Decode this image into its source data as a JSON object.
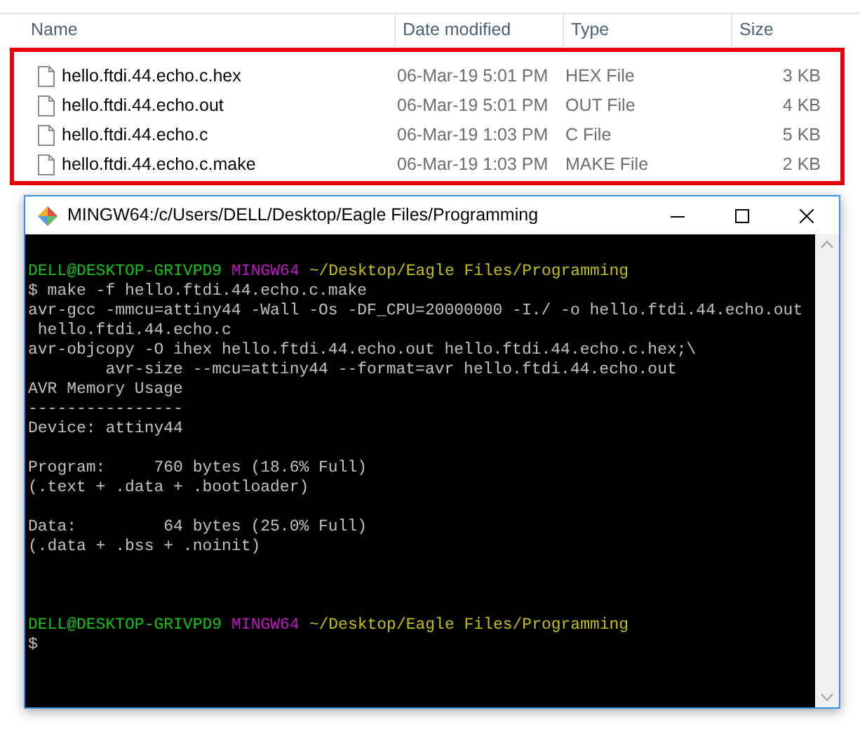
{
  "explorer": {
    "columns": [
      "Name",
      "Date modified",
      "Type",
      "Size"
    ],
    "rows": [
      {
        "name": "hello.ftdi.44.echo.c.hex",
        "date": "06-Mar-19 5:01 PM",
        "type": "HEX File",
        "size": "3 KB"
      },
      {
        "name": "hello.ftdi.44.echo.out",
        "date": "06-Mar-19 5:01 PM",
        "type": "OUT File",
        "size": "4 KB"
      },
      {
        "name": "hello.ftdi.44.echo.c",
        "date": "06-Mar-19 1:03 PM",
        "type": "C File",
        "size": "5 KB"
      },
      {
        "name": "hello.ftdi.44.echo.c.make",
        "date": "06-Mar-19 1:03 PM",
        "type": "MAKE File",
        "size": "2 KB"
      }
    ]
  },
  "terminal": {
    "title": "MINGW64:/c/Users/DELL/Desktop/Eagle Files/Programming",
    "lines": [
      {
        "kind": "blank"
      },
      {
        "kind": "prompt",
        "user": "DELL@DESKTOP-GRIVPD9",
        "system": "MINGW64",
        "path": "~/Desktop/Eagle Files/Programming"
      },
      {
        "kind": "text",
        "text": "$ make -f hello.ftdi.44.echo.c.make"
      },
      {
        "kind": "text",
        "text": "avr-gcc -mmcu=attiny44 -Wall -Os -DF_CPU=20000000 -I./ -o hello.ftdi.44.echo.out"
      },
      {
        "kind": "text",
        "text": " hello.ftdi.44.echo.c"
      },
      {
        "kind": "text",
        "text": "avr-objcopy -O ihex hello.ftdi.44.echo.out hello.ftdi.44.echo.c.hex;\\"
      },
      {
        "kind": "text",
        "text": "        avr-size --mcu=attiny44 --format=avr hello.ftdi.44.echo.out"
      },
      {
        "kind": "text",
        "text": "AVR Memory Usage"
      },
      {
        "kind": "text",
        "text": "----------------"
      },
      {
        "kind": "text",
        "text": "Device: attiny44"
      },
      {
        "kind": "blank"
      },
      {
        "kind": "text",
        "text": "Program:     760 bytes (18.6% Full)"
      },
      {
        "kind": "text",
        "text": "(.text + .data + .bootloader)"
      },
      {
        "kind": "blank"
      },
      {
        "kind": "text",
        "text": "Data:         64 bytes (25.0% Full)"
      },
      {
        "kind": "text",
        "text": "(.data + .bss + .noinit)"
      },
      {
        "kind": "blank"
      },
      {
        "kind": "blank"
      },
      {
        "kind": "blank"
      },
      {
        "kind": "prompt",
        "user": "DELL@DESKTOP-GRIVPD9",
        "system": "MINGW64",
        "path": "~/Desktop/Eagle Files/Programming"
      },
      {
        "kind": "text",
        "text": "$"
      }
    ]
  }
}
